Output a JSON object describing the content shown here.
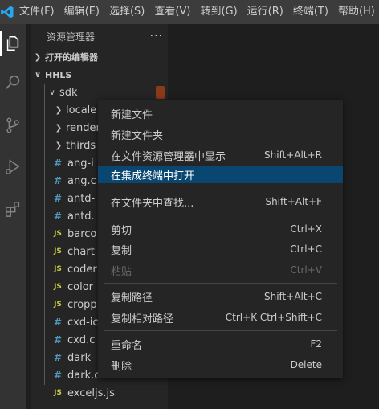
{
  "menubar": {
    "items": [
      "文件(F)",
      "编辑(E)",
      "选择(S)",
      "查看(V)",
      "转到(G)",
      "运行(R)",
      "终端(T)",
      "帮助(H)"
    ]
  },
  "sidebar": {
    "title": "资源管理器",
    "more": "···",
    "open_editors": "打开的编辑器",
    "workspace": "HHLS",
    "tree": [
      {
        "label": "sdk",
        "type": "folder",
        "twist": "open"
      },
      {
        "label": "locale",
        "type": "folder",
        "twist": "closed"
      },
      {
        "label": "render",
        "type": "folder",
        "twist": "closed"
      },
      {
        "label": "thirds",
        "type": "folder",
        "twist": "closed"
      },
      {
        "label": "ang-i",
        "type": "css"
      },
      {
        "label": "ang.c",
        "type": "css"
      },
      {
        "label": "antd-",
        "type": "css"
      },
      {
        "label": "antd.",
        "type": "css"
      },
      {
        "label": "barco",
        "type": "js"
      },
      {
        "label": "chart",
        "type": "js"
      },
      {
        "label": "coder",
        "type": "js"
      },
      {
        "label": "color",
        "type": "js"
      },
      {
        "label": "cropp",
        "type": "js"
      },
      {
        "label": "cxd-ic",
        "type": "css"
      },
      {
        "label": "cxd.c",
        "type": "css"
      },
      {
        "label": "dark-",
        "type": "css"
      },
      {
        "label": "dark.css",
        "type": "css"
      },
      {
        "label": "exceljs.js",
        "type": "js"
      }
    ]
  },
  "context_menu": {
    "items": [
      {
        "label": "新建文件",
        "key": ""
      },
      {
        "label": "新建文件夹",
        "key": ""
      },
      {
        "label": "在文件资源管理器中显示",
        "key": "Shift+Alt+R"
      },
      {
        "label": "在集成终端中打开",
        "key": "",
        "selected": true
      },
      {
        "label": "在文件夹中查找...",
        "key": "Shift+Alt+F"
      },
      {
        "label": "剪切",
        "key": "Ctrl+X"
      },
      {
        "label": "复制",
        "key": "Ctrl+C"
      },
      {
        "label": "粘贴",
        "key": "Ctrl+V",
        "disabled": true
      },
      {
        "label": "复制路径",
        "key": "Shift+Alt+C"
      },
      {
        "label": "复制相对路径",
        "key": "Ctrl+K Ctrl+Shift+C"
      },
      {
        "label": "重命名",
        "key": "F2"
      },
      {
        "label": "删除",
        "key": "Delete"
      }
    ]
  },
  "colors": {
    "accent": "#007acc",
    "selection": "#094771",
    "titlebar": "#3c3c3c",
    "sidebar": "#252526"
  },
  "icons": {
    "logo": "vscode-logo-icon",
    "activity": [
      "explorer-icon",
      "search-icon",
      "source-control-icon",
      "run-debug-icon",
      "extensions-icon"
    ]
  }
}
